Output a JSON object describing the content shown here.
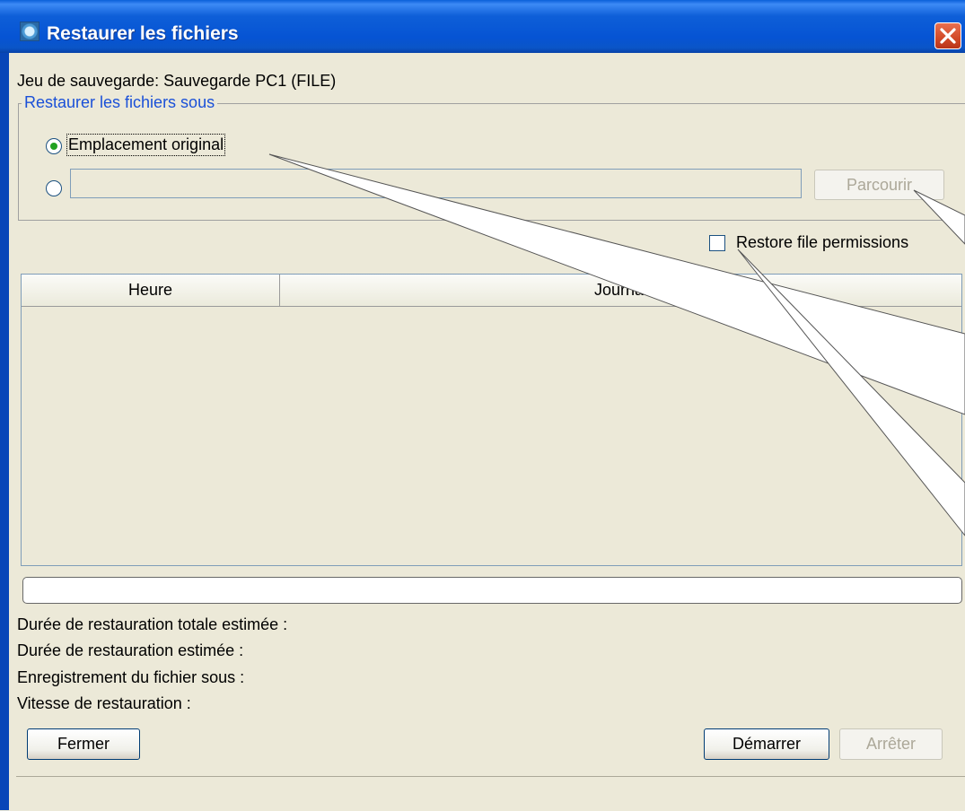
{
  "window": {
    "title": "Restaurer les fichiers",
    "close_icon": "close-icon"
  },
  "backup_set": {
    "label": "Jeu de sauvegarde: Sauvegarde PC1 (FILE)"
  },
  "restore_to": {
    "legend": "Restaurer les fichiers sous",
    "original_location_label": "Emplacement original",
    "original_selected": true,
    "custom_path_value": "",
    "browse_label": "Parcourir"
  },
  "options": {
    "restore_permissions_label": "Restore file permissions",
    "restore_permissions_checked": false
  },
  "log_table": {
    "columns": [
      "Heure",
      "Journal"
    ],
    "rows": []
  },
  "progress": {
    "value": 0
  },
  "stats": {
    "total_time_label": "Durée de restauration totale estimée :",
    "time_label": "Durée de restauration estimée :",
    "saving_as_label": "Enregistrement du fichier sous :",
    "speed_label": "Vitesse de restauration :"
  },
  "buttons": {
    "close": "Fermer",
    "start": "Démarrer",
    "stop": "Arrêter"
  },
  "colors": {
    "title_bar": "#0a5fd9",
    "legend": "#1a50d8",
    "radio_dot": "#21a121"
  }
}
